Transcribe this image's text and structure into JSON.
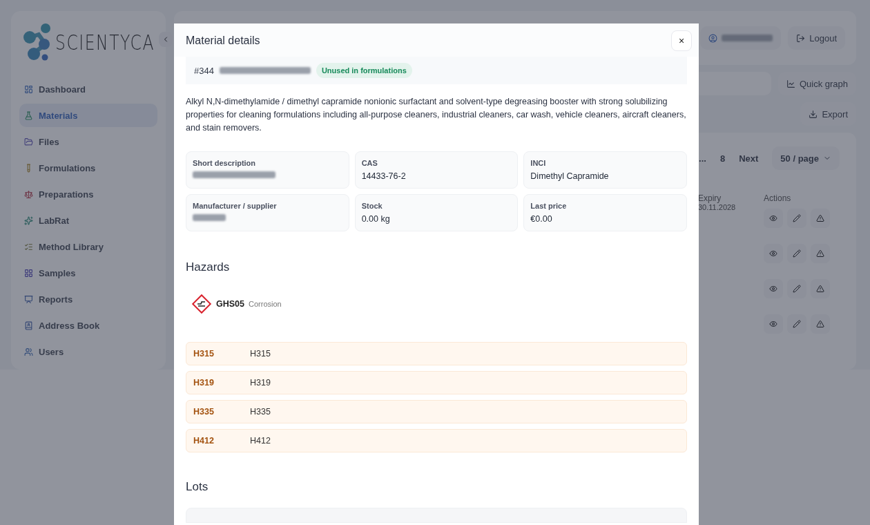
{
  "logo": {
    "text": "SCIENTYCA"
  },
  "sidebar": {
    "items": [
      {
        "label": "Dashboard",
        "selected": false
      },
      {
        "label": "Materials",
        "selected": true
      },
      {
        "label": "Files",
        "selected": false
      },
      {
        "label": "Formulations",
        "selected": false
      },
      {
        "label": "Preparations",
        "selected": false
      },
      {
        "label": "LabRat",
        "selected": false
      },
      {
        "label": "Method Library",
        "selected": false
      },
      {
        "label": "Samples",
        "selected": false
      },
      {
        "label": "Reports",
        "selected": false
      },
      {
        "label": "Address Book",
        "selected": false
      },
      {
        "label": "Users",
        "selected": false
      }
    ]
  },
  "topbar": {
    "logout": "Logout"
  },
  "toolbar": {
    "quick_graph": "Quick graph",
    "export": "Export"
  },
  "pagination": {
    "ellipsis": "...",
    "last_page": "8",
    "next": "Next",
    "page_size": "50 / page"
  },
  "table": {
    "columns": [
      "Expiry",
      "Actions"
    ],
    "rows": [
      {
        "expiry": "30.11.2028"
      },
      {},
      {},
      {}
    ]
  },
  "modal": {
    "title": "Material details",
    "close": "×",
    "material_number": "#344",
    "badge": "Unused in formulations",
    "description": "Alkyl N,N-dimethylamide / dimethyl capramide nonionic surfactant and solvent-type degreasing booster with strong solubilizing properties for cleaning formulations including all-purpose cleaners, industrial cleaners, car wash, vehicle cleaners, aircraft cleaners, and stain removers.",
    "fields": [
      {
        "label": "Short description",
        "redacted": true
      },
      {
        "label": "CAS",
        "value": "14433-76-2",
        "redacted": false
      },
      {
        "label": "INCI",
        "value": "Dimethyl Capramide",
        "redacted": false
      },
      {
        "label": "Manufacturer / supplier",
        "redacted": true
      },
      {
        "label": "Stock",
        "value": "0.00 kg",
        "redacted": false
      },
      {
        "label": "Last price",
        "value": "€0.00",
        "redacted": false
      }
    ],
    "hazards_heading": "Hazards",
    "pictograms": [
      {
        "code": "GHS05",
        "name": "Corrosion"
      }
    ],
    "statements": [
      {
        "code": "H315",
        "text": "H315"
      },
      {
        "code": "H319",
        "text": "H319"
      },
      {
        "code": "H335",
        "text": "H335"
      },
      {
        "code": "H412",
        "text": "H412"
      }
    ],
    "lots_heading": "Lots"
  }
}
